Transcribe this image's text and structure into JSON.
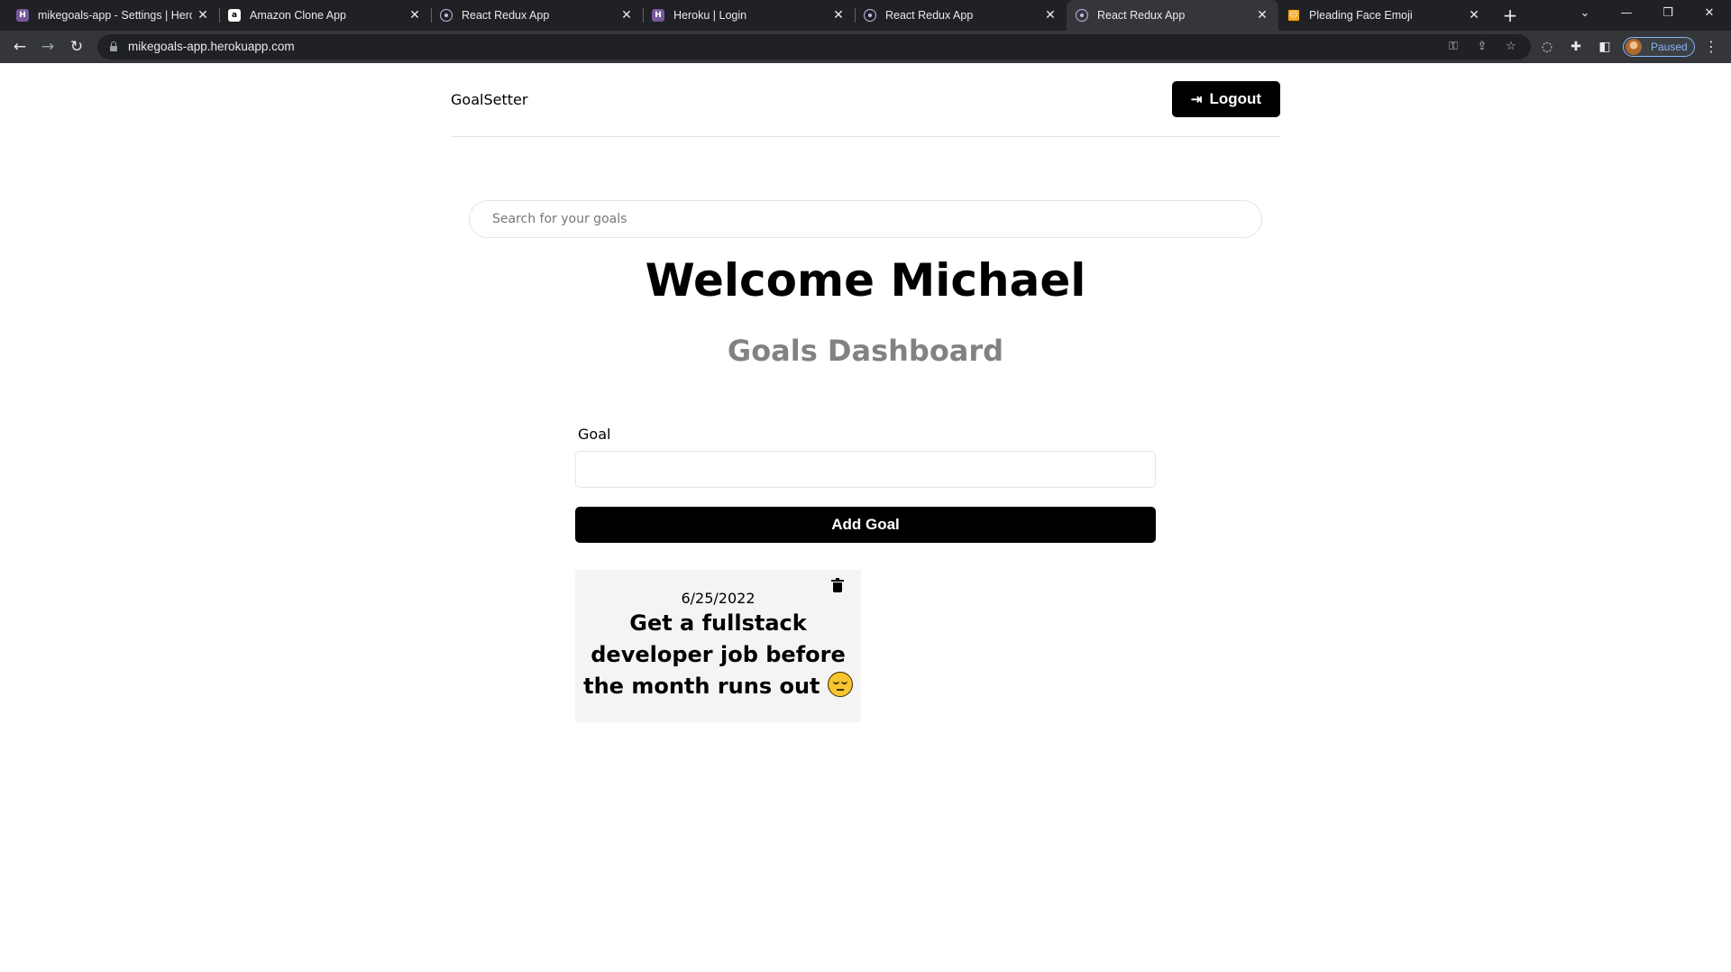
{
  "browser": {
    "tabs": [
      {
        "title": "mikegoals-app - Settings | Heroku",
        "favicon": "heroku"
      },
      {
        "title": "Amazon Clone App",
        "favicon": "amazon"
      },
      {
        "title": "React Redux App",
        "favicon": "react"
      },
      {
        "title": "Heroku | Login",
        "favicon": "heroku"
      },
      {
        "title": "React Redux App",
        "favicon": "react"
      },
      {
        "title": "React Redux App",
        "favicon": "react"
      },
      {
        "title": "Pleading Face Emoji",
        "favicon": "emoji"
      }
    ],
    "active_tab": 5,
    "url": "mikegoals-app.herokuapp.com",
    "profile_status": "Paused"
  },
  "app": {
    "logo": "GoalSetter",
    "logout_label": "Logout",
    "search_placeholder": "Search for your goals",
    "welcome": "Welcome Michael",
    "subtitle": "Goals Dashboard",
    "form": {
      "goal_label": "Goal",
      "goal_value": "",
      "submit_label": "Add Goal"
    },
    "goals": [
      {
        "date": "6/25/2022",
        "text": "Get a fullstack developer job before the month runs out",
        "emoji": "pleading-face"
      }
    ]
  },
  "colors": {
    "accent": "#000000",
    "subtitle": "#828282",
    "card_bg": "#f4f4f4",
    "chrome_bg": "#202124",
    "chrome_toolbar": "#35363a"
  }
}
